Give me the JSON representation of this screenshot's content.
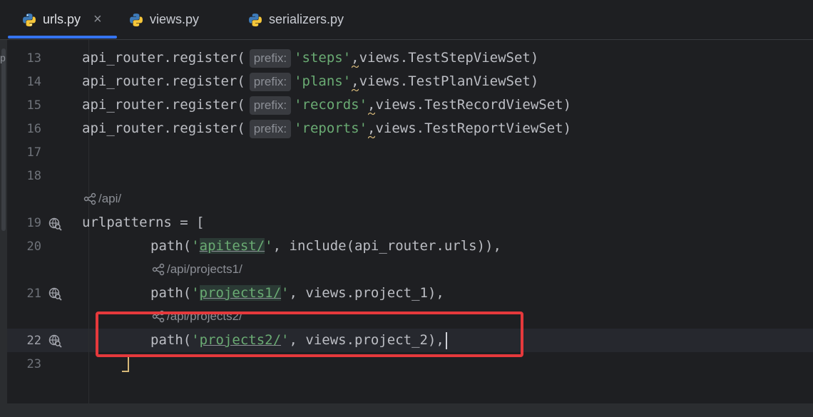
{
  "tabs": [
    {
      "label": "urls.py",
      "active": true
    },
    {
      "label": "views.py",
      "active": false
    },
    {
      "label": "serializers.py",
      "active": false
    }
  ],
  "tab_close_glyph": "×",
  "left_strip_char": "p",
  "colors": {
    "string": "#6aab73",
    "text": "#bcbec4",
    "accent": "#3574f0",
    "highlight_box": "#e5393c"
  },
  "lines": [
    {
      "n": "13",
      "prefix_hint": "prefix:",
      "pre": "api_router.register(",
      "str": "'steps'",
      "post": "views.TestStepViewSet)"
    },
    {
      "n": "14",
      "prefix_hint": "prefix:",
      "pre": "api_router.register(",
      "str": "'plans'",
      "post": "views.TestPlanViewSet)"
    },
    {
      "n": "15",
      "prefix_hint": "prefix:",
      "pre": "api_router.register(",
      "str": "'records'",
      "post": "views.TestRecordViewSet)"
    },
    {
      "n": "16",
      "prefix_hint": "prefix:",
      "pre": "api_router.register(",
      "str": "'reports'",
      "post": "views.TestReportViewSet)"
    },
    {
      "n": "17"
    },
    {
      "n": "18"
    },
    {
      "n": "19",
      "code": "urlpatterns = ["
    },
    {
      "n": "20",
      "pre": "path(",
      "q1": "'",
      "path": "apitest/",
      "q2": "'",
      "post": ", include(api_router.urls)),"
    },
    {
      "n": "21",
      "pre": "path(",
      "q1": "'",
      "path": "projects1/",
      "q2": "'",
      "post": ", views.project_1),"
    },
    {
      "n": "22",
      "pre": "path(",
      "q1": "'",
      "path": "projects2/",
      "q2": "'",
      "post": ", views.project_2),"
    },
    {
      "n": "23"
    }
  ],
  "annotations": {
    "api": "/api/",
    "projects1": "/api/projects1/",
    "projects2": "/api/projects2/"
  },
  "comma": ","
}
